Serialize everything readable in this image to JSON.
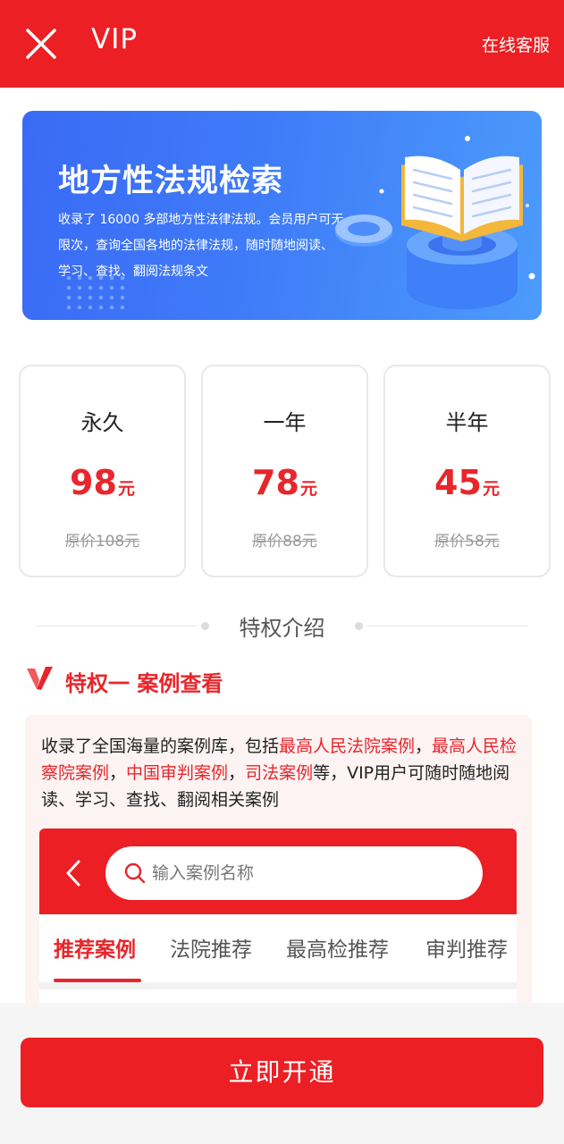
{
  "header": {
    "title": "VIP",
    "service_label": "在线客服"
  },
  "banner": {
    "title": "地方性法规检索",
    "description": "收录了 16000 多部地方性法律法规。会员用户可无限次，查询全国各地的法律法规，随时随地阅读、学习、查找、翻阅法规条文"
  },
  "plans": [
    {
      "name": "永久",
      "price": "98",
      "unit": "元",
      "original": "原价108元"
    },
    {
      "name": "一年",
      "price": "78",
      "unit": "元",
      "original": "原价88元"
    },
    {
      "name": "半年",
      "price": "45",
      "unit": "元",
      "original": "原价58元"
    }
  ],
  "section_title": "特权介绍",
  "privilege": {
    "title": "特权一  案例查看",
    "desc_parts": [
      "收录了全国海量的案例库，包括",
      "最高人民法院案例",
      "，",
      "最高人民检察院案例",
      "，",
      "中国审判案例",
      "，",
      "司法案例",
      "等，VIP用户可随时随地阅读、学习、查找、翻阅相关案例"
    ]
  },
  "mock_app": {
    "search_placeholder": "输入案例名称",
    "tabs": [
      "推荐案例",
      "法院推荐",
      "最高检推荐",
      "审判推荐"
    ]
  },
  "cta_label": "立即开通",
  "colors": {
    "brand_red": "#ec1f24",
    "banner_blue": "#3f7bf8"
  },
  "icons": [
    "close-icon",
    "book-icon",
    "check-v-icon",
    "back-chevron-icon",
    "search-icon"
  ]
}
